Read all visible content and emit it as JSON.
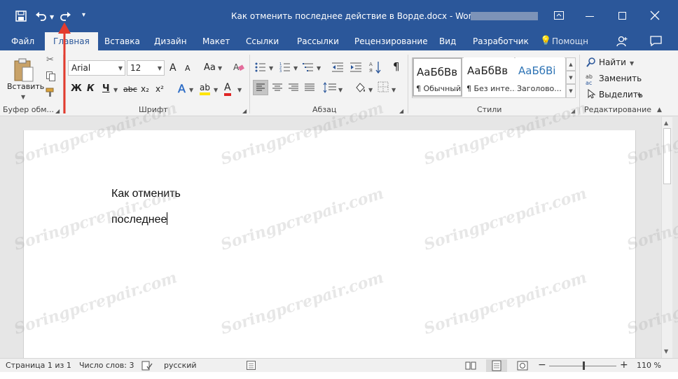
{
  "window": {
    "title": "Как отменить последнее действие в Ворде.docx - Word",
    "accent": "#2b579a"
  },
  "tabs": [
    {
      "label": "Файл"
    },
    {
      "label": "Главная"
    },
    {
      "label": "Вставка"
    },
    {
      "label": "Дизайн"
    },
    {
      "label": "Макет"
    },
    {
      "label": "Ссылки"
    },
    {
      "label": "Рассылки"
    },
    {
      "label": "Рецензирование"
    },
    {
      "label": "Вид"
    },
    {
      "label": "Разработчик"
    }
  ],
  "tell_me": "Помощн",
  "ribbon": {
    "clipboard": {
      "paste_label": "Вставить",
      "group_label": "Буфер обм..."
    },
    "font": {
      "name": "Arial",
      "size": "12",
      "grow": "A",
      "shrink": "A",
      "case": "Aa",
      "bold": "Ж",
      "italic": "К",
      "underline": "Ч",
      "strike": "abc",
      "sub": "x₂",
      "sup": "x²",
      "effects": "A",
      "highlight": "ab",
      "color": "A",
      "group_label": "Шрифт"
    },
    "paragraph": {
      "pilcrow": "¶",
      "group_label": "Абзац"
    },
    "styles": {
      "items": [
        {
          "sample": "АаБбВв",
          "name": "¶ Обычный"
        },
        {
          "sample": "АаБбВв",
          "name": "¶ Без инте..."
        },
        {
          "sample": "АаБбВі",
          "name": "Заголово..."
        }
      ],
      "group_label": "Стили"
    },
    "editing": {
      "find": "Найти",
      "replace": "Заменить",
      "select": "Выделить",
      "group_label": "Редактирование"
    }
  },
  "document": {
    "lines": [
      "Как отменить",
      "последнее"
    ]
  },
  "watermark": "Soringpcrepair.com",
  "status": {
    "page": "Страница 1 из 1",
    "words": "Число слов: 3",
    "language": "русский",
    "zoom": "110 %",
    "zoom_minus": "−",
    "zoom_plus": "+"
  }
}
